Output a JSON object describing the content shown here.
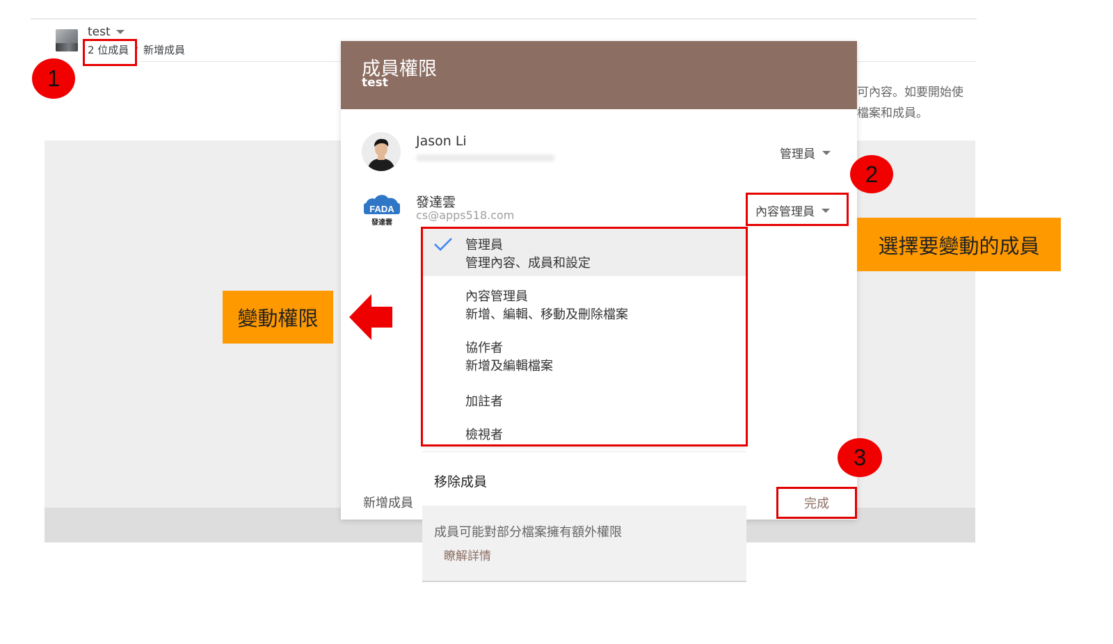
{
  "drive": {
    "name": "test",
    "members_link": "2 位成員",
    "separator": "·",
    "add_member_link": "新增成員",
    "description_line1": "可內容。如要開始使",
    "description_line2": "檔案和成員。"
  },
  "dialog": {
    "title": "成員權限",
    "subtitle": "test",
    "members": [
      {
        "name": "Jason Li",
        "email": "",
        "role": "管理員"
      },
      {
        "name": "發達雲",
        "email": "cs@apps518.com",
        "role": "內容管理員",
        "avatar_text_top": "FADA",
        "avatar_text_bottom": "發達雲"
      }
    ],
    "role_options": [
      {
        "title": "管理員",
        "description": "管理內容、成員和設定",
        "selected": true
      },
      {
        "title": "內容管理員",
        "description": "新增、編輯、移動及刪除檔案",
        "selected": false
      },
      {
        "title": "協作者",
        "description": "新增及編輯檔案",
        "selected": false
      },
      {
        "title": "加註者",
        "description": "",
        "selected": false
      },
      {
        "title": "檢視者",
        "description": "",
        "selected": false
      }
    ],
    "remove_member": "移除成員",
    "add_member": "新增成員",
    "info_text": "成員可能對部分檔案擁有額外權限",
    "learn_more": "瞭解詳情",
    "done": "完成"
  },
  "annotations": {
    "step1": "1",
    "step2": "2",
    "step3": "3",
    "callout_select_member": "選擇要變動的成員",
    "callout_change_permission": "變動權限"
  },
  "colors": {
    "header_brown": "#8d6e63",
    "annotation_red": "#f10000",
    "callout_orange": "#ff9900",
    "check_blue": "#4285f4"
  }
}
